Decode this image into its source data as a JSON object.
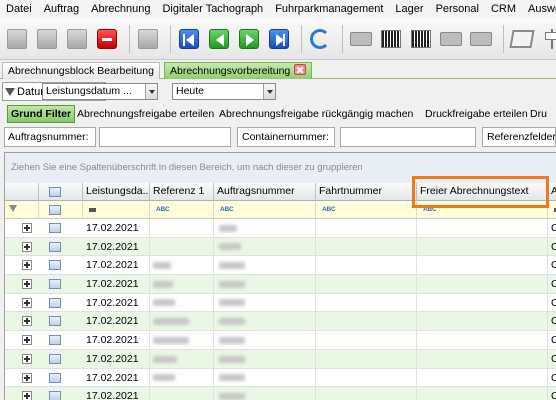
{
  "menu": [
    "Datei",
    "Auftrag",
    "Abrechnung",
    "Digitaler Tachograph",
    "Fuhrparkmanagement",
    "Lager",
    "Personal",
    "CRM",
    "Auswer"
  ],
  "tabs": [
    {
      "label": "Abrechnungsblock Bearbeitung",
      "active": false
    },
    {
      "label": "Abrechnungsvorbereitung",
      "active": true
    }
  ],
  "filter": {
    "label": "Datum:",
    "field_select": "Leistungsdatum ...",
    "period_select": "Heute"
  },
  "actions": {
    "basic_filter": "Grund Filter",
    "approve": "Abrechnungsfreigabe erteilen",
    "revoke": "Abrechnungsfreigabe rückgängig machen",
    "print_approve": "Druckfreigabe erteilen",
    "print_more": "Dru"
  },
  "search": {
    "order_label": "Auftragsnummer:",
    "order_value": "",
    "container_label": "Containernummer:",
    "container_value": "",
    "reference_label": "Referenzfelder:"
  },
  "grid": {
    "group_hint": "Ziehen Sie eine Spaltenüberschrift in diesen Bereich, um nach dieser zu gruppieren",
    "columns": [
      "Leistungsda...",
      "Referenz 1",
      "Auftragsnummer",
      "Fahrtnummer",
      "Freier Abrechnungstext",
      "Ab"
    ],
    "filter_abc": "ABC",
    "rows": [
      {
        "date": "17.02.2021",
        "last": "CT"
      },
      {
        "date": "17.02.2021",
        "last": "CT"
      },
      {
        "date": "17.02.2021",
        "last": "CC"
      },
      {
        "date": "17.02.2021",
        "last": "CT"
      },
      {
        "date": "17.02.2021",
        "last": "CT"
      },
      {
        "date": "17.02.2021",
        "last": "CC"
      },
      {
        "date": "17.02.2021",
        "last": "CC"
      },
      {
        "date": "17.02.2021",
        "last": "CC"
      },
      {
        "date": "17.02.2021",
        "last": "CC"
      },
      {
        "date": "17.02.2021",
        "last": "CC"
      }
    ]
  },
  "colors": {
    "active_tab": "#8fcf6a",
    "highlight": "#ec7a1c",
    "filter_row": "#fffcd9",
    "alt_row": "#eaf7e5"
  }
}
